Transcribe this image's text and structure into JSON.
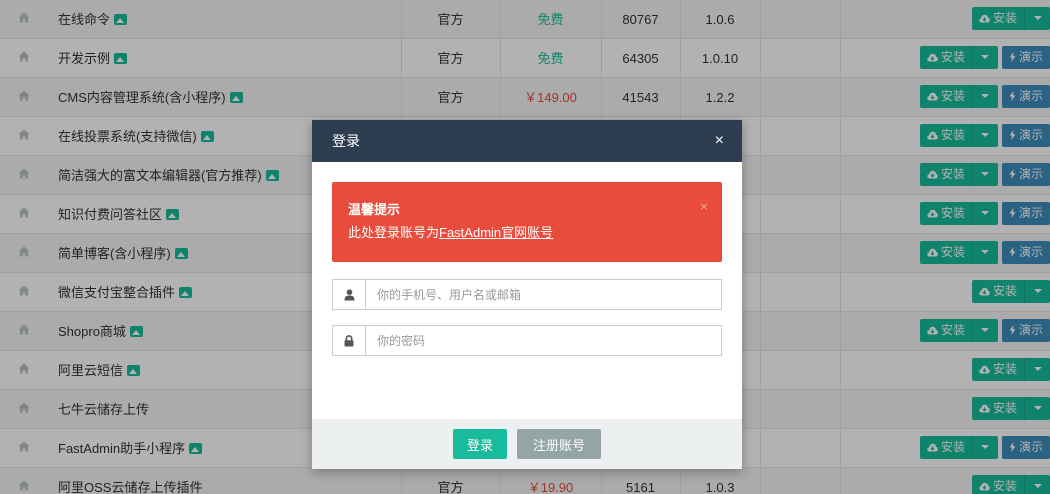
{
  "table": {
    "rows": [
      {
        "name": "在线命令",
        "img": true,
        "author": "官方",
        "price": "免费",
        "price_type": "free",
        "downloads": "80767",
        "version": "1.0.6",
        "demo": false
      },
      {
        "name": "开发示例",
        "img": true,
        "author": "官方",
        "price": "免费",
        "price_type": "free",
        "downloads": "64305",
        "version": "1.0.10",
        "demo": true
      },
      {
        "name": "CMS内容管理系统(含小程序)",
        "img": true,
        "author": "官方",
        "price": "￥149.00",
        "price_type": "paid",
        "downloads": "41543",
        "version": "1.2.2",
        "demo": true
      },
      {
        "name": "在线投票系统(支持微信)",
        "img": true,
        "author": "",
        "price": "",
        "price_type": "",
        "downloads": "",
        "version": "",
        "demo": true
      },
      {
        "name": "简洁强大的富文本编辑器(官方推荐)",
        "img": true,
        "author": "",
        "price": "",
        "price_type": "",
        "downloads": "",
        "version": "",
        "demo": true
      },
      {
        "name": "知识付费问答社区",
        "img": true,
        "author": "",
        "price": "",
        "price_type": "",
        "downloads": "",
        "version": "",
        "demo": true
      },
      {
        "name": "简单博客(含小程序)",
        "img": true,
        "author": "",
        "price": "",
        "price_type": "",
        "downloads": "",
        "version": "",
        "demo": true
      },
      {
        "name": "微信支付宝整合插件",
        "img": true,
        "author": "",
        "price": "",
        "price_type": "",
        "downloads": "",
        "version": "",
        "demo": false
      },
      {
        "name": "Shopro商城",
        "img": true,
        "author": "",
        "price": "",
        "price_type": "",
        "downloads": "",
        "version": "",
        "demo": true
      },
      {
        "name": "阿里云短信",
        "img": true,
        "author": "",
        "price": "",
        "price_type": "",
        "downloads": "",
        "version": "",
        "demo": false
      },
      {
        "name": "七牛云储存上传",
        "img": false,
        "author": "",
        "price": "",
        "price_type": "",
        "downloads": "",
        "version": "",
        "demo": false
      },
      {
        "name": "FastAdmin助手小程序",
        "img": true,
        "author": "",
        "price": "",
        "price_type": "",
        "downloads": "",
        "version": "",
        "demo": true
      },
      {
        "name": "阿里OSS云储存上传插件",
        "img": false,
        "author": "官方",
        "price": "￥19.90",
        "price_type": "paid",
        "downloads": "5161",
        "version": "1.0.3",
        "demo": false
      }
    ],
    "install_label": "安装",
    "demo_label": "演示"
  },
  "modal": {
    "title": "登录",
    "close_symbol": "×",
    "alert": {
      "title": "温馨提示",
      "text_prefix": "此处登录账号为",
      "link_text": "FastAdmin官网账号",
      "close_symbol": "×"
    },
    "username_placeholder": "你的手机号、用户名或邮箱",
    "password_placeholder": "你的密码",
    "login_label": "登录",
    "register_label": "注册账号"
  },
  "colors": {
    "success": "#18bc9c",
    "info": "#3c8dbc",
    "danger": "#e74c3c",
    "header": "#2c3e50"
  }
}
